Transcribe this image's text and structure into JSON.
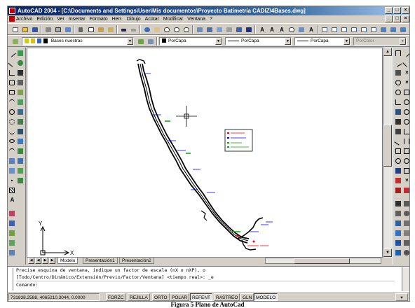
{
  "window": {
    "title": "AutoCAD 2004 - [C:\\Documents and Settings\\User\\Mis documentos\\Proyecto Batimetría CADIZ\\4Bases.dwg]",
    "buttons": [
      "_",
      "□",
      "×"
    ]
  },
  "menu": {
    "items": [
      "Archivo",
      "Edición",
      "Ver",
      "Insertar",
      "Formato",
      "Herr.",
      "Dibujo",
      "Acotar",
      "Modificar",
      "Ventana",
      "?"
    ],
    "doc_buttons": [
      "_",
      "□",
      "×"
    ]
  },
  "toolbar": {
    "layer_combo": "Bases nuestras",
    "color_combo": "PorCapa",
    "linetype_combo": "PorCapa",
    "lineweight_combo": "PorCapa",
    "plotstyle_combo": "PorColor",
    "icons_row1": [
      "new-icon",
      "open-icon",
      "save-icon",
      "print-icon",
      "preview-icon",
      "publish-icon",
      "cut-icon",
      "copy-icon",
      "paste-icon",
      "matchprop-icon",
      "undo-icon",
      "redo-icon",
      "hyperlink-icon",
      "pan-icon",
      "zoom-realtime-icon",
      "zoom-window-icon",
      "zoom-previous-icon",
      "properties-icon",
      "designcenter-icon",
      "toolpalette-icon",
      "dbconnect-icon",
      "markup-icon",
      "help-icon"
    ],
    "text_icons": [
      "A",
      "A",
      "A",
      "A"
    ]
  },
  "drawing": {
    "ucs_x": "X",
    "ucs_y": "Y",
    "legend_lines": [
      "Legend text 1",
      "Legend text 2",
      "Legend text 3",
      "Legend text 4"
    ],
    "colors": {
      "route": "#000000",
      "label_red": "#ff0000",
      "label_blue": "#0000ff",
      "label_green": "#00aa00"
    }
  },
  "tabs": {
    "items": [
      "Modelo",
      "Presentación1",
      "Presentación2"
    ],
    "active": "Modelo"
  },
  "command": {
    "line1": "Precise esquina de ventana, indique un factor de escala (nX o nXP), o",
    "line2": "[Todo/Centro/Dinámico/Extensión/Previo/Factor/Ventana] <tiempo real>: _e",
    "prompt": "Comando:"
  },
  "status": {
    "coords": "731838.2588, 4065210.3044, 0.0000",
    "toggles": [
      "FORZC",
      "REJILLA",
      "ORTO",
      "POLAR",
      "REFENT",
      "RASTREO",
      "GLN",
      "MODELO"
    ]
  },
  "caption": "Figura 5 Plano de AutoCad"
}
